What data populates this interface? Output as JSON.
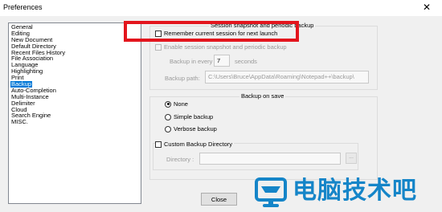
{
  "window": {
    "title": "Preferences",
    "close_glyph": "✕"
  },
  "sidebar": {
    "items": [
      {
        "label": "General"
      },
      {
        "label": "Editing"
      },
      {
        "label": "New Document"
      },
      {
        "label": "Default Directory"
      },
      {
        "label": "Recent Files History"
      },
      {
        "label": "File Association"
      },
      {
        "label": "Language"
      },
      {
        "label": "Highlighting"
      },
      {
        "label": "Print"
      },
      {
        "label": "Backup"
      },
      {
        "label": "Auto-Completion"
      },
      {
        "label": "Multi-Instance"
      },
      {
        "label": "Delimiter"
      },
      {
        "label": "Cloud"
      },
      {
        "label": "Search Engine"
      },
      {
        "label": "MISC."
      }
    ],
    "selected": "Backup"
  },
  "session": {
    "legend": "Session snapshot and periodic backup",
    "remember_label": "Remember current session for next launch",
    "remember_checked": false,
    "enable_label": "Enable session snapshot and periodic backup",
    "enable_checked": false,
    "backup_every_label": "Backup in every",
    "backup_every_value": "7",
    "seconds_label": "seconds",
    "backup_path_label": "Backup path:",
    "backup_path_value": "C:\\Users\\Bruce\\AppData\\Roaming\\Notepad++\\backup\\"
  },
  "backup_on_save": {
    "legend": "Backup on save",
    "options": [
      {
        "label": "None",
        "selected": true
      },
      {
        "label": "Simple backup",
        "selected": false
      },
      {
        "label": "Verbose backup",
        "selected": false
      }
    ],
    "custom_dir_label": "Custom Backup Directory",
    "custom_dir_checked": false,
    "directory_label": "Directory :",
    "directory_value": "",
    "browse_label": "..."
  },
  "footer": {
    "close_label": "Close"
  },
  "watermark": {
    "text": "电脑技术吧",
    "accent": "#1585c8"
  },
  "colors": {
    "highlight": "#e3151d",
    "selection": "#0078d7"
  }
}
